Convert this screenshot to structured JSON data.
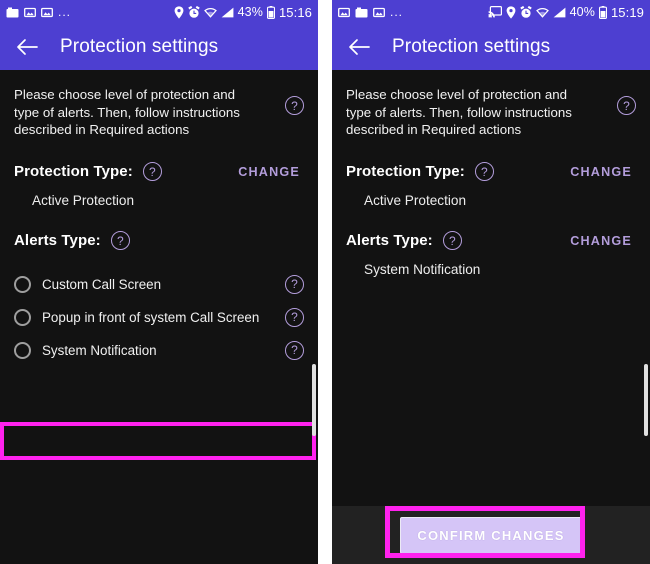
{
  "panels": [
    {
      "id": "left",
      "statusbar": {
        "left_icons": [
          "screenshot-icon",
          "image-icon",
          "image-icon"
        ],
        "overflow": "...",
        "right_icons": [
          "location-icon",
          "alarm-icon",
          "wifi-icon",
          "signal-icon"
        ],
        "battery_percent": "43%",
        "battery_icon": "battery-icon",
        "time": "15:16"
      },
      "appbar": {
        "back_icon": "arrow-back-icon",
        "title": "Protection settings"
      },
      "description": "Please choose level of protection and type of alerts. Then, follow instructions described in Required actions",
      "help_glyph": "?",
      "protection": {
        "label": "Protection Type:",
        "change_label": "CHANGE",
        "value": "Active Protection"
      },
      "alerts": {
        "label": "Alerts Type:",
        "change_label": "",
        "options": [
          {
            "label": "Custom Call Screen",
            "selected": false,
            "highlighted": false
          },
          {
            "label": "Popup in front of system Call Screen",
            "selected": false,
            "highlighted": false
          },
          {
            "label": "System Notification",
            "selected": false,
            "highlighted": true
          }
        ]
      },
      "confirm_label": ""
    },
    {
      "id": "right",
      "statusbar": {
        "left_icons": [
          "image-icon",
          "screenshot-icon",
          "image-icon"
        ],
        "overflow": "...",
        "right_icons": [
          "cast-icon",
          "location-icon",
          "alarm-icon",
          "wifi-icon",
          "signal-icon"
        ],
        "battery_percent": "40%",
        "battery_icon": "battery-icon",
        "time": "15:19"
      },
      "appbar": {
        "back_icon": "arrow-back-icon",
        "title": "Protection settings"
      },
      "description": "Please choose level of protection and type of alerts. Then, follow instructions described in Required actions",
      "help_glyph": "?",
      "protection": {
        "label": "Protection Type:",
        "change_label": "CHANGE",
        "value": "Active Protection"
      },
      "alerts": {
        "label": "Alerts Type:",
        "change_label": "CHANGE",
        "value": "System Notification",
        "options": []
      },
      "confirm_label": "CONFIRM CHANGES"
    }
  ],
  "colors": {
    "appbar": "#4d3fd1",
    "background": "#121212",
    "accent": "#b39ddb",
    "highlight": "#ff22ee",
    "confirm_button": "#d5c5f7"
  }
}
